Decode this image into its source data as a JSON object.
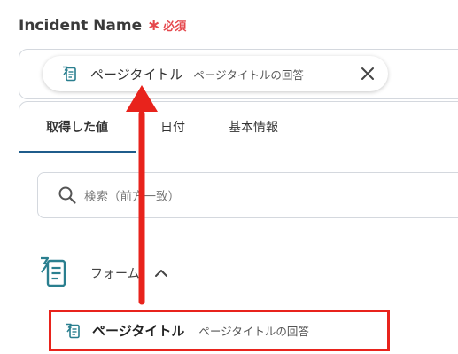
{
  "field": {
    "label": "Incident Name",
    "required_mark": "∗",
    "required_text": "必須"
  },
  "chip": {
    "title": "ページタイトル",
    "subtitle": "ページタイトルの回答",
    "icon": "form-document-icon",
    "close_icon": "close-icon"
  },
  "tabs": [
    {
      "label": "取得した値",
      "active": true
    },
    {
      "label": "日付",
      "active": false
    },
    {
      "label": "基本情報",
      "active": false
    }
  ],
  "search": {
    "placeholder": "検索（前方一致）",
    "icon": "search-icon"
  },
  "group": {
    "label": "フォーム",
    "expanded": true,
    "icon": "form-document-icon",
    "toggle_icon": "chevron-up-icon"
  },
  "result": {
    "title": "ページタイトル",
    "subtitle": "ページタイトルの回答",
    "icon": "form-document-icon"
  },
  "colors": {
    "accent": "#1f5c8b",
    "icon_teal": "#2a7f8f",
    "required": "#e5484d",
    "highlight": "#e8231c"
  }
}
